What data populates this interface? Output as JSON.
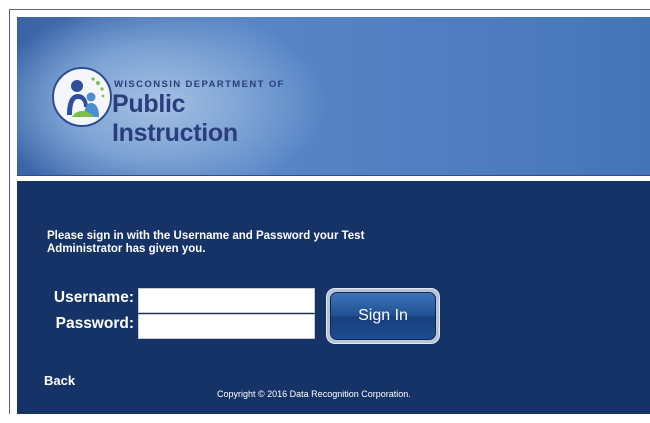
{
  "header": {
    "logo": {
      "top_text": "WISCONSIN DEPARTMENT OF",
      "main_text": "Public Instruction",
      "icon": "dpi-family-logo-icon"
    }
  },
  "login": {
    "instructions": "Please sign in with the Username and Password your Test Administrator has given you.",
    "username_label": "Username:",
    "username_value": "",
    "password_label": "Password:",
    "password_value": "",
    "signin_label": "Sign In"
  },
  "footer": {
    "back_label": "Back",
    "copyright": "Copyright © 2016 Data Recognition Corporation."
  },
  "colors": {
    "panel_bg": "#163367",
    "header_blue": "#4f7dc0",
    "logo_text": "#2a3d7c",
    "button_blue": "#214f93"
  }
}
